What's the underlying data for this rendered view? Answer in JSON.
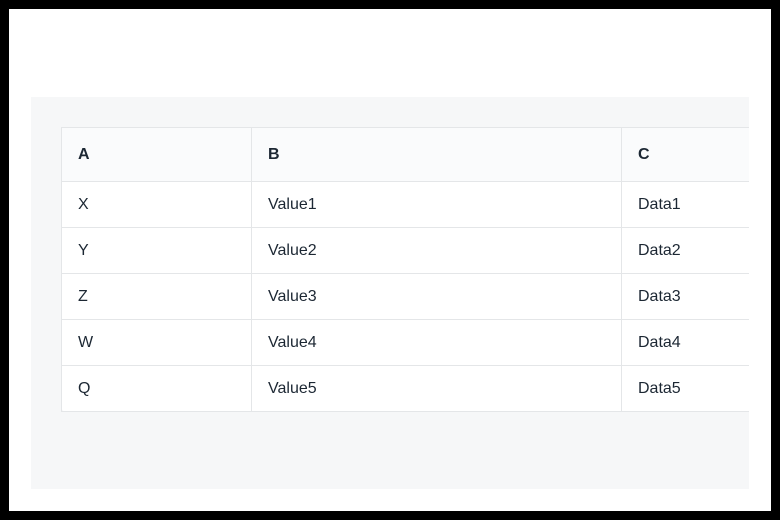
{
  "table": {
    "headers": [
      "A",
      "B",
      "C"
    ],
    "rows": [
      {
        "a": "X",
        "b": "Value1",
        "c": "Data1"
      },
      {
        "a": "Y",
        "b": "Value2",
        "c": "Data2"
      },
      {
        "a": "Z",
        "b": "Value3",
        "c": "Data3"
      },
      {
        "a": "W",
        "b": "Value4",
        "c": "Data4"
      },
      {
        "a": "Q",
        "b": "Value5",
        "c": "Data5"
      }
    ]
  }
}
